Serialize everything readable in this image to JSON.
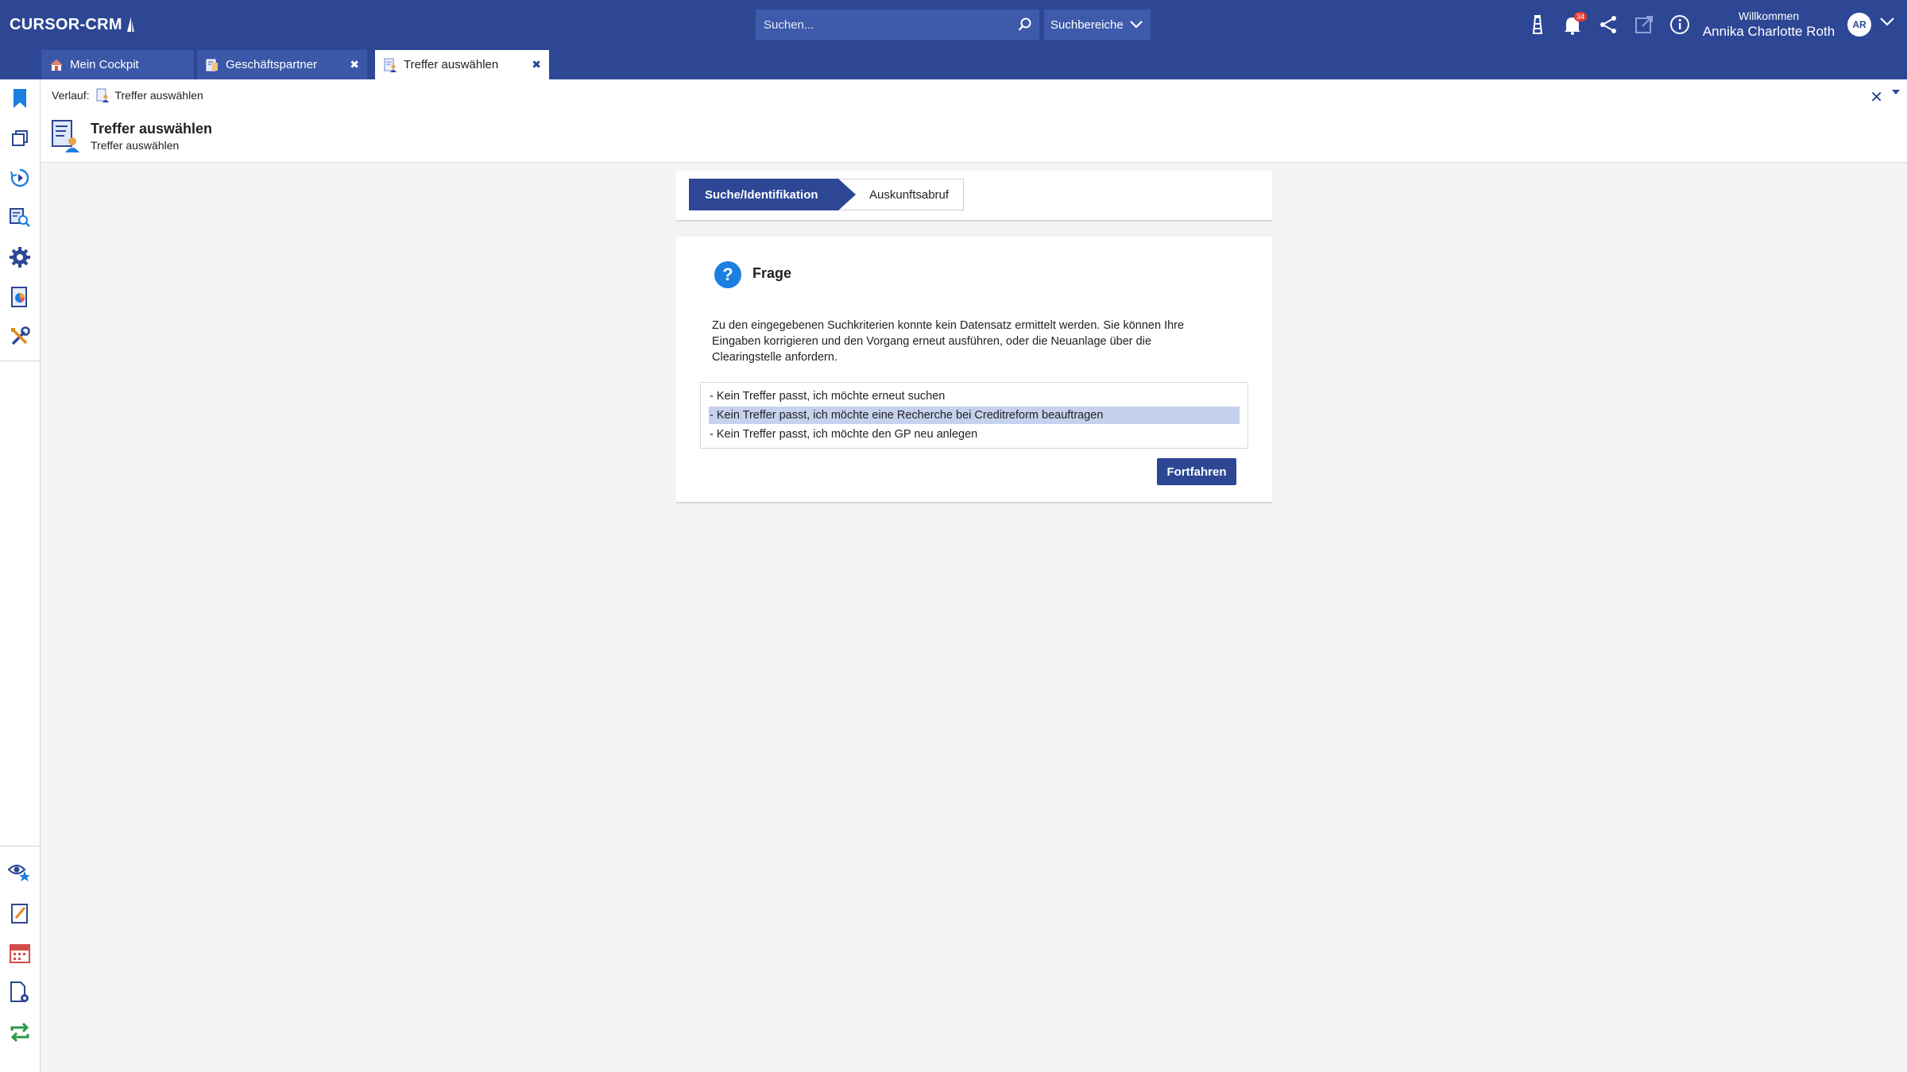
{
  "app": {
    "logo": "CURSOR-CRM",
    "search_placeholder": "Suchen...",
    "search_scope_label": "Suchbereiche",
    "notification_count": "34",
    "welcome_label": "Willkommen",
    "user_name": "Annika Charlotte Roth",
    "user_initials": "AR"
  },
  "tabs": [
    {
      "label": "Mein Cockpit",
      "icon": "home-icon",
      "active": false
    },
    {
      "label": "Geschäftspartner",
      "icon": "business-partner-icon",
      "active": false
    },
    {
      "label": "Treffer auswählen",
      "icon": "document-person-icon",
      "active": true
    }
  ],
  "sidebar": {
    "top_icons": [
      "bookmark-icon",
      "copy-window-icon",
      "history-icon",
      "search-document-icon",
      "settings-gear-icon",
      "report-icon",
      "tools-icon"
    ],
    "bottom_icons": [
      "watch-star-icon",
      "edit-note-icon",
      "calendar-icon",
      "document-settings-icon",
      "sync-icon"
    ]
  },
  "header": {
    "breadcrumb_label": "Verlauf:",
    "breadcrumb_item": "Treffer auswählen",
    "title": "Treffer auswählen",
    "subtitle": "Treffer auswählen"
  },
  "steps": [
    {
      "label": "Suche/Identifikation",
      "active": true
    },
    {
      "label": "Auskunftsabruf",
      "active": false
    }
  ],
  "question": {
    "title": "Frage",
    "text": "Zu den eingegebenen Suchkriterien konnte kein Datensatz ermittelt werden. Sie können Ihre Eingaben korrigieren und den Vorgang erneut ausführen, oder die Neuanlage über die Clearingstelle anfordern.",
    "options": [
      "- Kein Treffer passt, ich möchte erneut suchen",
      "- Kein Treffer passt, ich möchte eine Recherche bei Creditreform beauftragen",
      "- Kein Treffer passt, ich möchte den GP neu anlegen"
    ],
    "selected_index": 1,
    "continue_label": "Fortfahren"
  },
  "colors": {
    "brand": "#2d4795",
    "selection": "#c6d1ee",
    "question_icon": "#1c7fe0",
    "notification_badge": "#e53935"
  }
}
